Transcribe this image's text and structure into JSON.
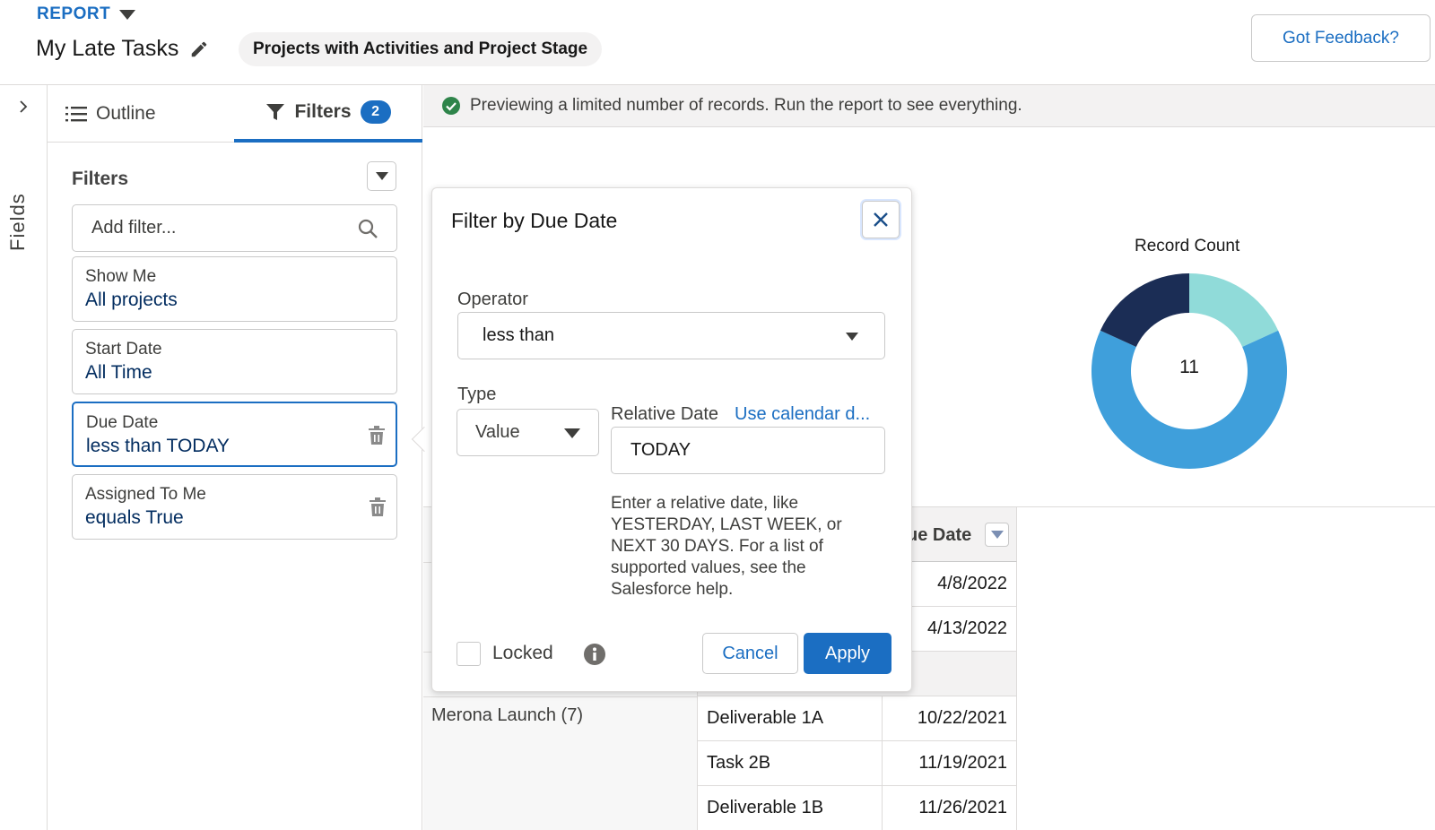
{
  "header": {
    "report_label": "REPORT",
    "title": "My Late Tasks",
    "report_type": "Projects with Activities and Project Stage",
    "feedback_button": "Got Feedback?"
  },
  "fields_rail": {
    "label": "Fields"
  },
  "left_panel": {
    "tabs": [
      {
        "label": "Outline",
        "icon": "list-icon"
      },
      {
        "label": "Filters",
        "icon": "filter-icon",
        "count": "2"
      }
    ],
    "filters_heading": "Filters",
    "add_filter_placeholder": "Add filter...",
    "filter_cards": [
      {
        "label": "Show Me",
        "value": "All projects"
      },
      {
        "label": "Start Date",
        "value": "All Time"
      },
      {
        "label": "Due Date",
        "value": "less than TODAY",
        "active": true
      },
      {
        "label": "Assigned To Me",
        "value": "equals True"
      }
    ]
  },
  "preview": {
    "message": "Previewing a limited number of records. Run the report to see everything."
  },
  "chart": {
    "title": "Record Count",
    "center_value": "11"
  },
  "chart_data": {
    "type": "pie",
    "title": "Record Count",
    "total": 11,
    "slices": [
      {
        "value": 2,
        "color": "#90dbd9"
      },
      {
        "value": 7,
        "color": "#3f9fdb"
      },
      {
        "value": 2,
        "color": "#1b2d55"
      }
    ]
  },
  "table": {
    "due_date_header": "ue Date",
    "group_label": "Merona Launch (7)",
    "top_rows": [
      {
        "date": "4/8/2022"
      },
      {
        "date": "4/13/2022"
      }
    ],
    "rows": [
      {
        "name": "Deliverable 1A",
        "date": "10/22/2021"
      },
      {
        "name": "Task 2B",
        "date": "11/19/2021"
      },
      {
        "name": "Deliverable 1B",
        "date": "11/26/2021"
      }
    ]
  },
  "popover": {
    "title": "Filter by Due Date",
    "operator_label": "Operator",
    "operator_value": "less than",
    "type_label": "Type",
    "type_value": "Value",
    "relative_date_label": "Relative Date",
    "calendar_link": "Use calendar d...",
    "date_value": "TODAY",
    "help_text": "Enter a relative date, like YESTERDAY, LAST WEEK, or NEXT 30 DAYS. For a list of supported values, see the Salesforce help.",
    "locked_label": "Locked",
    "locked_checked": false,
    "cancel_button": "Cancel",
    "apply_button": "Apply"
  },
  "colors": {
    "accent": "#1b6ec2",
    "navy": "#032d60"
  }
}
